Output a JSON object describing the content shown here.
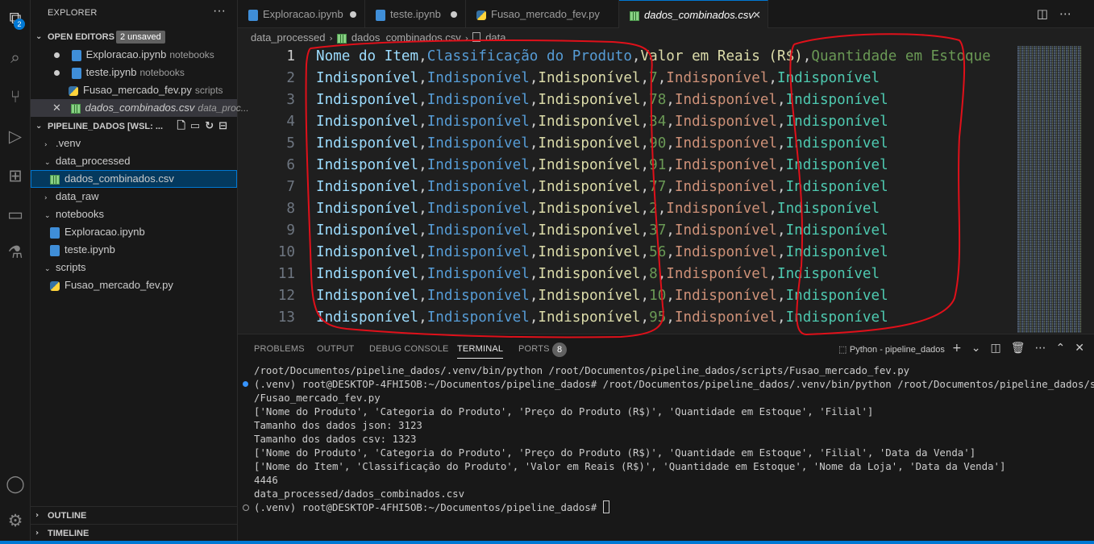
{
  "activity_bar": {
    "explorer_badge": "2"
  },
  "sidebar": {
    "title": "EXPLORER",
    "more": "···",
    "open_editors": {
      "label": "OPEN EDITORS",
      "unsaved": "2 unsaved",
      "items": [
        {
          "name": "Exploracao.ipynb",
          "desc": "notebooks"
        },
        {
          "name": "teste.ipynb",
          "desc": "notebooks"
        },
        {
          "name": "Fusao_mercado_fev.py",
          "desc": "scripts"
        },
        {
          "name": "dados_combinados.csv",
          "desc": "data_proc..."
        }
      ]
    },
    "workspace": {
      "label": "PIPELINE_DADOS [WSL: ...",
      "tree": [
        {
          "name": ".venv"
        },
        {
          "name": "data_processed"
        },
        {
          "name": "dados_combinados.csv"
        },
        {
          "name": "data_raw"
        },
        {
          "name": "notebooks"
        },
        {
          "name": "Exploracao.ipynb"
        },
        {
          "name": "teste.ipynb"
        },
        {
          "name": "scripts"
        },
        {
          "name": "Fusao_mercado_fev.py"
        }
      ]
    },
    "outline": "OUTLINE",
    "timeline": "TIMELINE"
  },
  "tabs": [
    {
      "label": "Exploracao.ipynb"
    },
    {
      "label": "teste.ipynb"
    },
    {
      "label": "Fusao_mercado_fev.py"
    },
    {
      "label": "dados_combinados.csv"
    }
  ],
  "breadcrumb": {
    "folder": "data_processed",
    "file": "dados_combinados.csv",
    "symbol": "data"
  },
  "editor": {
    "lines": [
      {
        "n": "1",
        "cols": [
          "Nome do Item",
          "Classificação do Produto",
          "Valor em Reais (R$)",
          "Quantidade em Estoque"
        ]
      },
      {
        "n": "2",
        "cols": [
          "Indisponível",
          "Indisponível",
          "Indisponível",
          "7",
          "Indisponível",
          "Indisponível"
        ]
      },
      {
        "n": "3",
        "cols": [
          "Indisponível",
          "Indisponível",
          "Indisponível",
          "78",
          "Indisponível",
          "Indisponível"
        ]
      },
      {
        "n": "4",
        "cols": [
          "Indisponível",
          "Indisponível",
          "Indisponível",
          "34",
          "Indisponível",
          "Indisponível"
        ]
      },
      {
        "n": "5",
        "cols": [
          "Indisponível",
          "Indisponível",
          "Indisponível",
          "90",
          "Indisponível",
          "Indisponível"
        ]
      },
      {
        "n": "6",
        "cols": [
          "Indisponível",
          "Indisponível",
          "Indisponível",
          "91",
          "Indisponível",
          "Indisponível"
        ]
      },
      {
        "n": "7",
        "cols": [
          "Indisponível",
          "Indisponível",
          "Indisponível",
          "77",
          "Indisponível",
          "Indisponível"
        ]
      },
      {
        "n": "8",
        "cols": [
          "Indisponível",
          "Indisponível",
          "Indisponível",
          "2",
          "Indisponível",
          "Indisponível"
        ]
      },
      {
        "n": "9",
        "cols": [
          "Indisponível",
          "Indisponível",
          "Indisponível",
          "37",
          "Indisponível",
          "Indisponível"
        ]
      },
      {
        "n": "10",
        "cols": [
          "Indisponível",
          "Indisponível",
          "Indisponível",
          "56",
          "Indisponível",
          "Indisponível"
        ]
      },
      {
        "n": "11",
        "cols": [
          "Indisponível",
          "Indisponível",
          "Indisponível",
          "8",
          "Indisponível",
          "Indisponível"
        ]
      },
      {
        "n": "12",
        "cols": [
          "Indisponível",
          "Indisponível",
          "Indisponível",
          "10",
          "Indisponível",
          "Indisponível"
        ]
      },
      {
        "n": "13",
        "cols": [
          "Indisponível",
          "Indisponível",
          "Indisponível",
          "95",
          "Indisponível",
          "Indisponível"
        ]
      }
    ]
  },
  "panel": {
    "tabs": [
      "PROBLEMS",
      "OUTPUT",
      "DEBUG CONSOLE",
      "TERMINAL",
      "PORTS"
    ],
    "ports_badge": "8",
    "terminal_name": "Python - pipeline_dados",
    "terminal_lines": [
      "/root/Documentos/pipeline_dados/.venv/bin/python /root/Documentos/pipeline_dados/scripts/Fusao_mercado_fev.py",
      "(.venv) root@DESKTOP-4FHI5OB:~/Documentos/pipeline_dados# /root/Documentos/pipeline_dados/.venv/bin/python /root/Documentos/pipeline_dados/scripts",
      "/Fusao_mercado_fev.py",
      "['Nome do Produto', 'Categoria do Produto', 'Preço do Produto (R$)', 'Quantidade em Estoque', 'Filial']",
      "Tamanho dos dados json: 3123",
      "Tamanho dos dados csv: 1323",
      "['Nome do Produto', 'Categoria do Produto', 'Preço do Produto (R$)', 'Quantidade em Estoque', 'Filial', 'Data da Venda']",
      "['Nome do Item', 'Classificação do Produto', 'Valor em Reais (R$)', 'Quantidade em Estoque', 'Nome da Loja', 'Data da Venda']",
      "4446",
      "data_processed/dados_combinados.csv",
      "(.venv) root@DESKTOP-4FHI5OB:~/Documentos/pipeline_dados# "
    ]
  },
  "colors": {
    "accent": "#0078d4",
    "annotation": "#e0101a"
  }
}
